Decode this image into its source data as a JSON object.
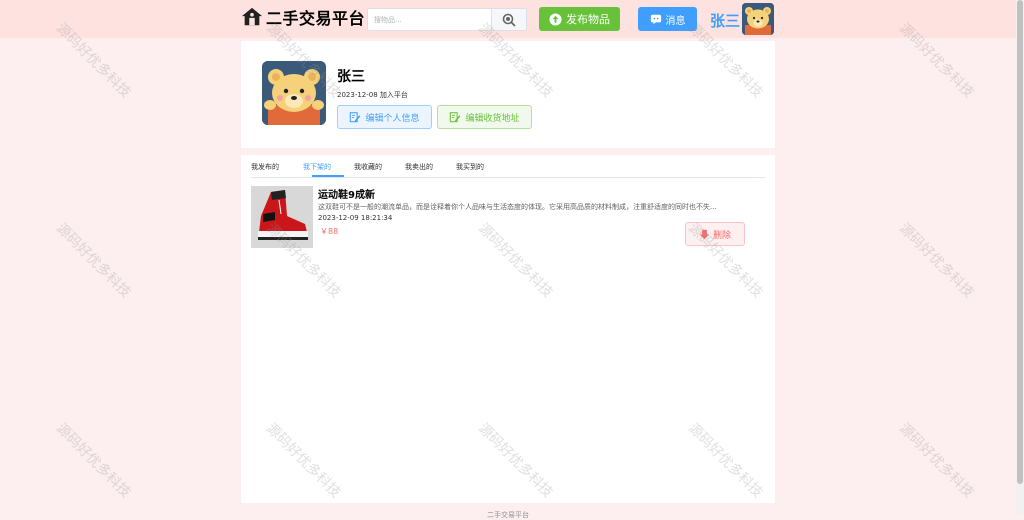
{
  "header": {
    "logo_text": "二手交易平台",
    "search_placeholder": "搜物品...",
    "publish_label": "发布物品",
    "message_label": "消息",
    "username": "张三"
  },
  "profile": {
    "name": "张三",
    "joined": "2023-12-08 加入平台",
    "edit_info_label": "编辑个人信息",
    "edit_address_label": "编辑收货地址"
  },
  "tabs": [
    {
      "label": "我发布的",
      "active": false
    },
    {
      "label": "我下架的",
      "active": true
    },
    {
      "label": "我收藏的",
      "active": false
    },
    {
      "label": "我卖出的",
      "active": false
    },
    {
      "label": "我买到的",
      "active": false
    }
  ],
  "items": [
    {
      "title": "运动鞋9成新",
      "description": "这双鞋可不是一般的潮流单品，而是诠释着你个人品味与生活态度的体现。它采用高品质的材料制成，注重舒适度的同时也不失...",
      "time": "2023-12-09 18:21:34",
      "price": "￥88",
      "delete_label": "删除"
    }
  ],
  "footer": "二手交易平台",
  "watermark": "源码好优多科技",
  "colors": {
    "primary": "#409eff",
    "success": "#67c23a",
    "danger": "#f56c6c",
    "topbar": "#fde2e0",
    "page_bg": "#fdeef0"
  },
  "icons": {
    "logo": "house-icon",
    "search": "search-icon",
    "publish": "upload-icon",
    "message": "message-icon",
    "edit_info": "edit-icon",
    "edit_address": "address-edit-icon",
    "delete": "download-delete-icon"
  }
}
